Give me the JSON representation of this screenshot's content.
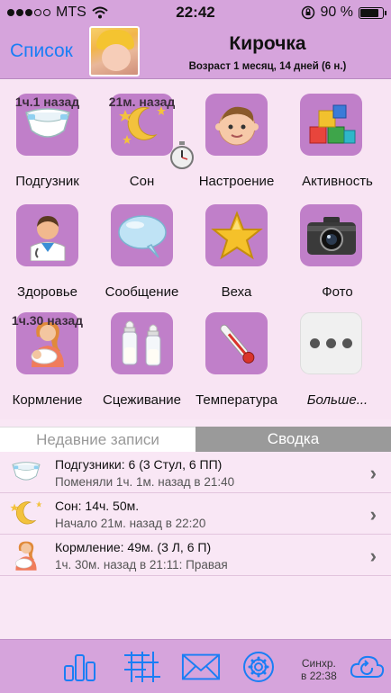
{
  "status_bar": {
    "carrier": "MTS",
    "time": "22:42",
    "battery": "90 %",
    "battery_level": 0.9
  },
  "nav": {
    "back_label": "Список",
    "child_name": "Кирочка",
    "age": "Возраст 1 месяц, 14 дней  (6 н.)"
  },
  "tiles": [
    {
      "label": "Подгузник",
      "timer": "1ч.1 назад",
      "icon": "diaper-icon"
    },
    {
      "label": "Сон",
      "timer": "21м. назад",
      "icon": "moon-sleep-icon"
    },
    {
      "label": "Настроение",
      "timer": "",
      "icon": "baby-face-icon"
    },
    {
      "label": "Активность",
      "timer": "",
      "icon": "toy-blocks-icon"
    },
    {
      "label": "Здоровье",
      "timer": "",
      "icon": "doctor-icon"
    },
    {
      "label": "Сообщение",
      "timer": "",
      "icon": "speech-bubble-icon"
    },
    {
      "label": "Веха",
      "timer": "",
      "icon": "star-icon"
    },
    {
      "label": "Фото",
      "timer": "",
      "icon": "camera-icon"
    },
    {
      "label": "Кормление",
      "timer": "1ч.30 назад",
      "icon": "mother-feeding-icon"
    },
    {
      "label": "Сцеживание",
      "timer": "",
      "icon": "baby-bottles-icon"
    },
    {
      "label": "Температура",
      "timer": "",
      "icon": "thermometer-icon"
    },
    {
      "label": "Больше...",
      "timer": "",
      "icon": "more-dots-icon"
    }
  ],
  "segments": {
    "recent": "Недавние записи",
    "summary": "Сводка",
    "active": "summary"
  },
  "records": [
    {
      "title": "Подгузники: 6 (3 Стул, 6 ПП)",
      "detail": "Поменяли 1ч. 1м. назад в 21:40",
      "icon": "diaper-icon"
    },
    {
      "title": "Сон: 14ч. 50м.",
      "detail": "Начало 21м. назад в 22:20",
      "icon": "moon-sleep-icon"
    },
    {
      "title": "Кормление: 49м. (3 Л, 6 П)",
      "detail": "1ч. 30м. назад в 21:11: Правая",
      "icon": "mother-feeding-icon"
    }
  ],
  "tabbar": {
    "sync_label": "Синхр.",
    "sync_time": "в 22:38"
  },
  "colors": {
    "bar": "#d6a4dc",
    "tile": "#c07fc9",
    "accent": "#1a7ef5",
    "background": "#f9e7f5"
  }
}
